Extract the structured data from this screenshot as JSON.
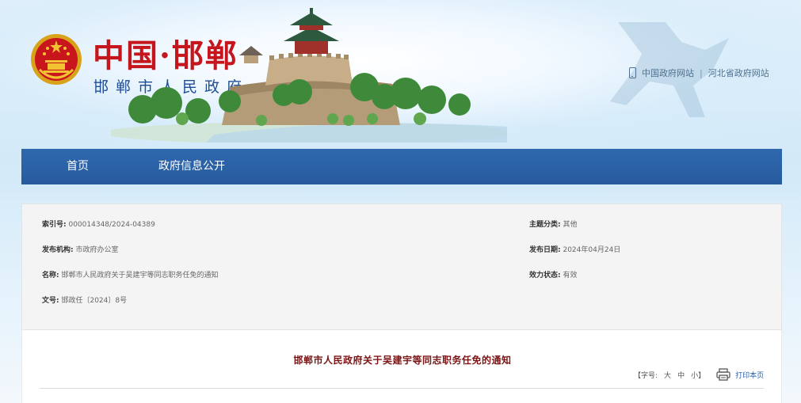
{
  "header": {
    "logo_title": "中国·邯郸",
    "logo_subtitle": "邯郸市人民政府",
    "links": [
      "中国政府网站",
      "河北省政府网站"
    ],
    "icons": {
      "emblem": "national-emblem-icon",
      "mobile": "mobile-phone-icon"
    },
    "colors": {
      "logo_red": "#c4161c",
      "subtitle_blue": "#1e4d96"
    }
  },
  "nav": {
    "items": [
      "首页",
      "政府信息公开"
    ],
    "color": "#2a61a6"
  },
  "meta": {
    "index_label": "索引号:",
    "index_value": "000014348/2024-04389",
    "topic_label": "主题分类:",
    "topic_value": "其他",
    "publisher_label": "发布机构:",
    "publisher_value": "市政府办公室",
    "date_label": "发布日期:",
    "date_value": "2024年04月24日",
    "name_label": "名称:",
    "name_value": "邯郸市人民政府关于吴建宇等同志职务任免的通知",
    "status_label": "效力状态:",
    "status_value": "有效",
    "docno_label": "文号:",
    "docno_value": "邯政任〔2024〕8号"
  },
  "article": {
    "title": "邯郸市人民政府关于吴建宇等同志职务任免的通知",
    "font_size_label": "【字号:",
    "font_sizes": [
      "大",
      "中",
      "小"
    ],
    "font_size_close": "】",
    "print_label": "打印本页",
    "title_color": "#7a1414"
  }
}
